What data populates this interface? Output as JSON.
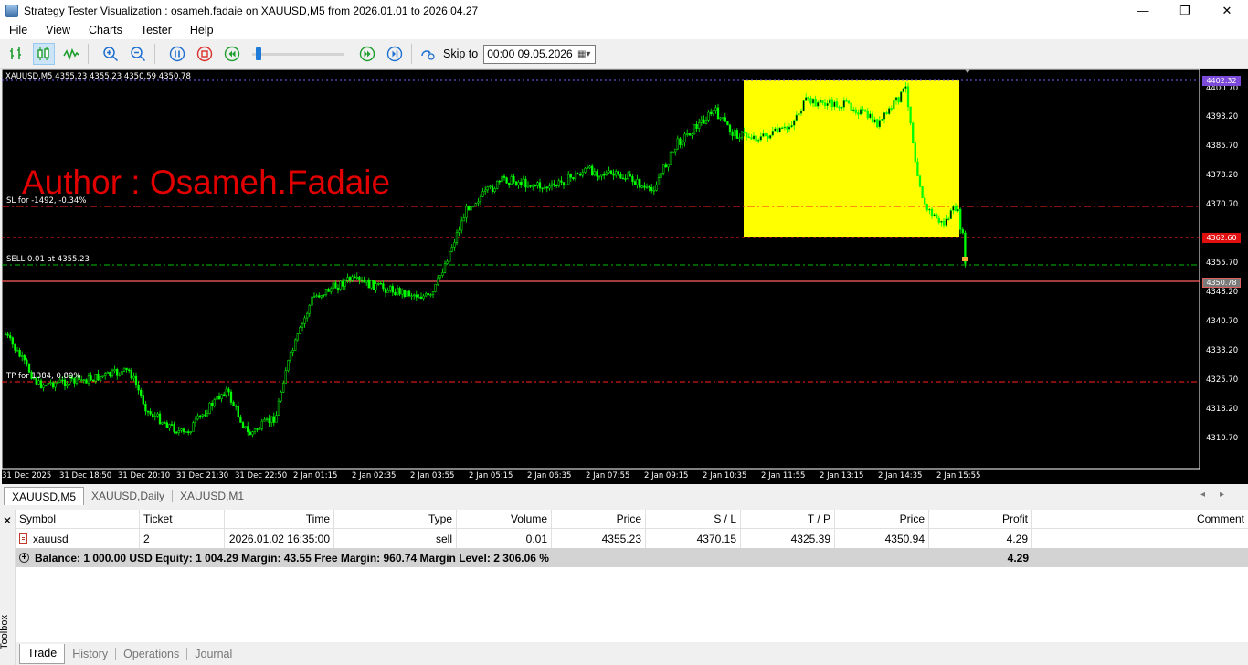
{
  "window": {
    "title": "Strategy Tester Visualization : osameh.fadaie on XAUUSD,M5 from 2026.01.01 to 2026.04.27",
    "minimize": "—",
    "maximize": "❐",
    "close": "✕"
  },
  "menu": [
    "File",
    "View",
    "Charts",
    "Tester",
    "Help"
  ],
  "toolbar": {
    "skip_label": "Skip to",
    "skip_value": "00:00 09.05.2026",
    "icons": [
      "bar-chart-icon",
      "candles-icon",
      "line-chart-icon",
      "zoom-in-icon",
      "zoom-out-icon",
      "pause-icon",
      "stop-icon",
      "rewind-icon",
      "fast-forward-icon",
      "step-forward-icon",
      "skip-to-icon"
    ]
  },
  "chart": {
    "info": "XAUUSD,M5  4355.23 4355.23 4350.59 4350.78",
    "author": "Author : Osameh.Fadaie",
    "sl_label": "SL for -1492, -0.34%",
    "sell_label": "SELL 0.01 at 4355.23",
    "tp_label": "TP for 1384, 0.89%",
    "price_ticks": [
      "4400.70",
      "4393.20",
      "4385.70",
      "4378.20",
      "4370.70",
      "4355.70",
      "4348.20",
      "4340.70",
      "4333.20",
      "4325.70",
      "4318.20",
      "4310.70"
    ],
    "price_boxes": {
      "top": "4402.32",
      "sl": "4362.60",
      "bid": "4350.78"
    },
    "time_labels": [
      "31 Dec 2025",
      "31 Dec 18:50",
      "31 Dec 20:10",
      "31 Dec 21:30",
      "31 Dec 22:50",
      "2 Jan 01:15",
      "2 Jan 02:35",
      "2 Jan 03:55",
      "2 Jan 05:15",
      "2 Jan 06:35",
      "2 Jan 07:55",
      "2 Jan 09:15",
      "2 Jan 10:35",
      "2 Jan 11:55",
      "2 Jan 13:15",
      "2 Jan 14:35",
      "2 Jan 15:55"
    ],
    "colors": {
      "background": "#000000",
      "candle": "#00ff00",
      "highlight": "#ffff00",
      "sl_line": "#ff0000",
      "tp_line": "#ff0000",
      "sell_line": "#00c000",
      "author": "#e00000"
    }
  },
  "chart_tabs": [
    "XAUUSD,M5",
    "XAUUSD,Daily",
    "XAUUSD,M1"
  ],
  "table": {
    "headers": [
      "Symbol",
      "Ticket",
      "Time",
      "Type",
      "Volume",
      "Price",
      "S / L",
      "T / P",
      "Price",
      "Profit",
      "Comment"
    ],
    "rows": [
      [
        "xauusd",
        "2",
        "2026.01.02 16:35:00",
        "sell",
        "0.01",
        "4355.23",
        "4370.15",
        "4325.39",
        "4350.94",
        "4.29",
        ""
      ]
    ],
    "balance_text": "Balance: 1 000.00 USD  Equity: 1 004.29  Margin: 43.55  Free Margin: 960.74  Margin Level: 2 306.06 %",
    "balance_profit": "4.29"
  },
  "toolbox": {
    "label": "Toolbox",
    "tabs": [
      "Trade",
      "History",
      "Operations",
      "Journal"
    ]
  }
}
